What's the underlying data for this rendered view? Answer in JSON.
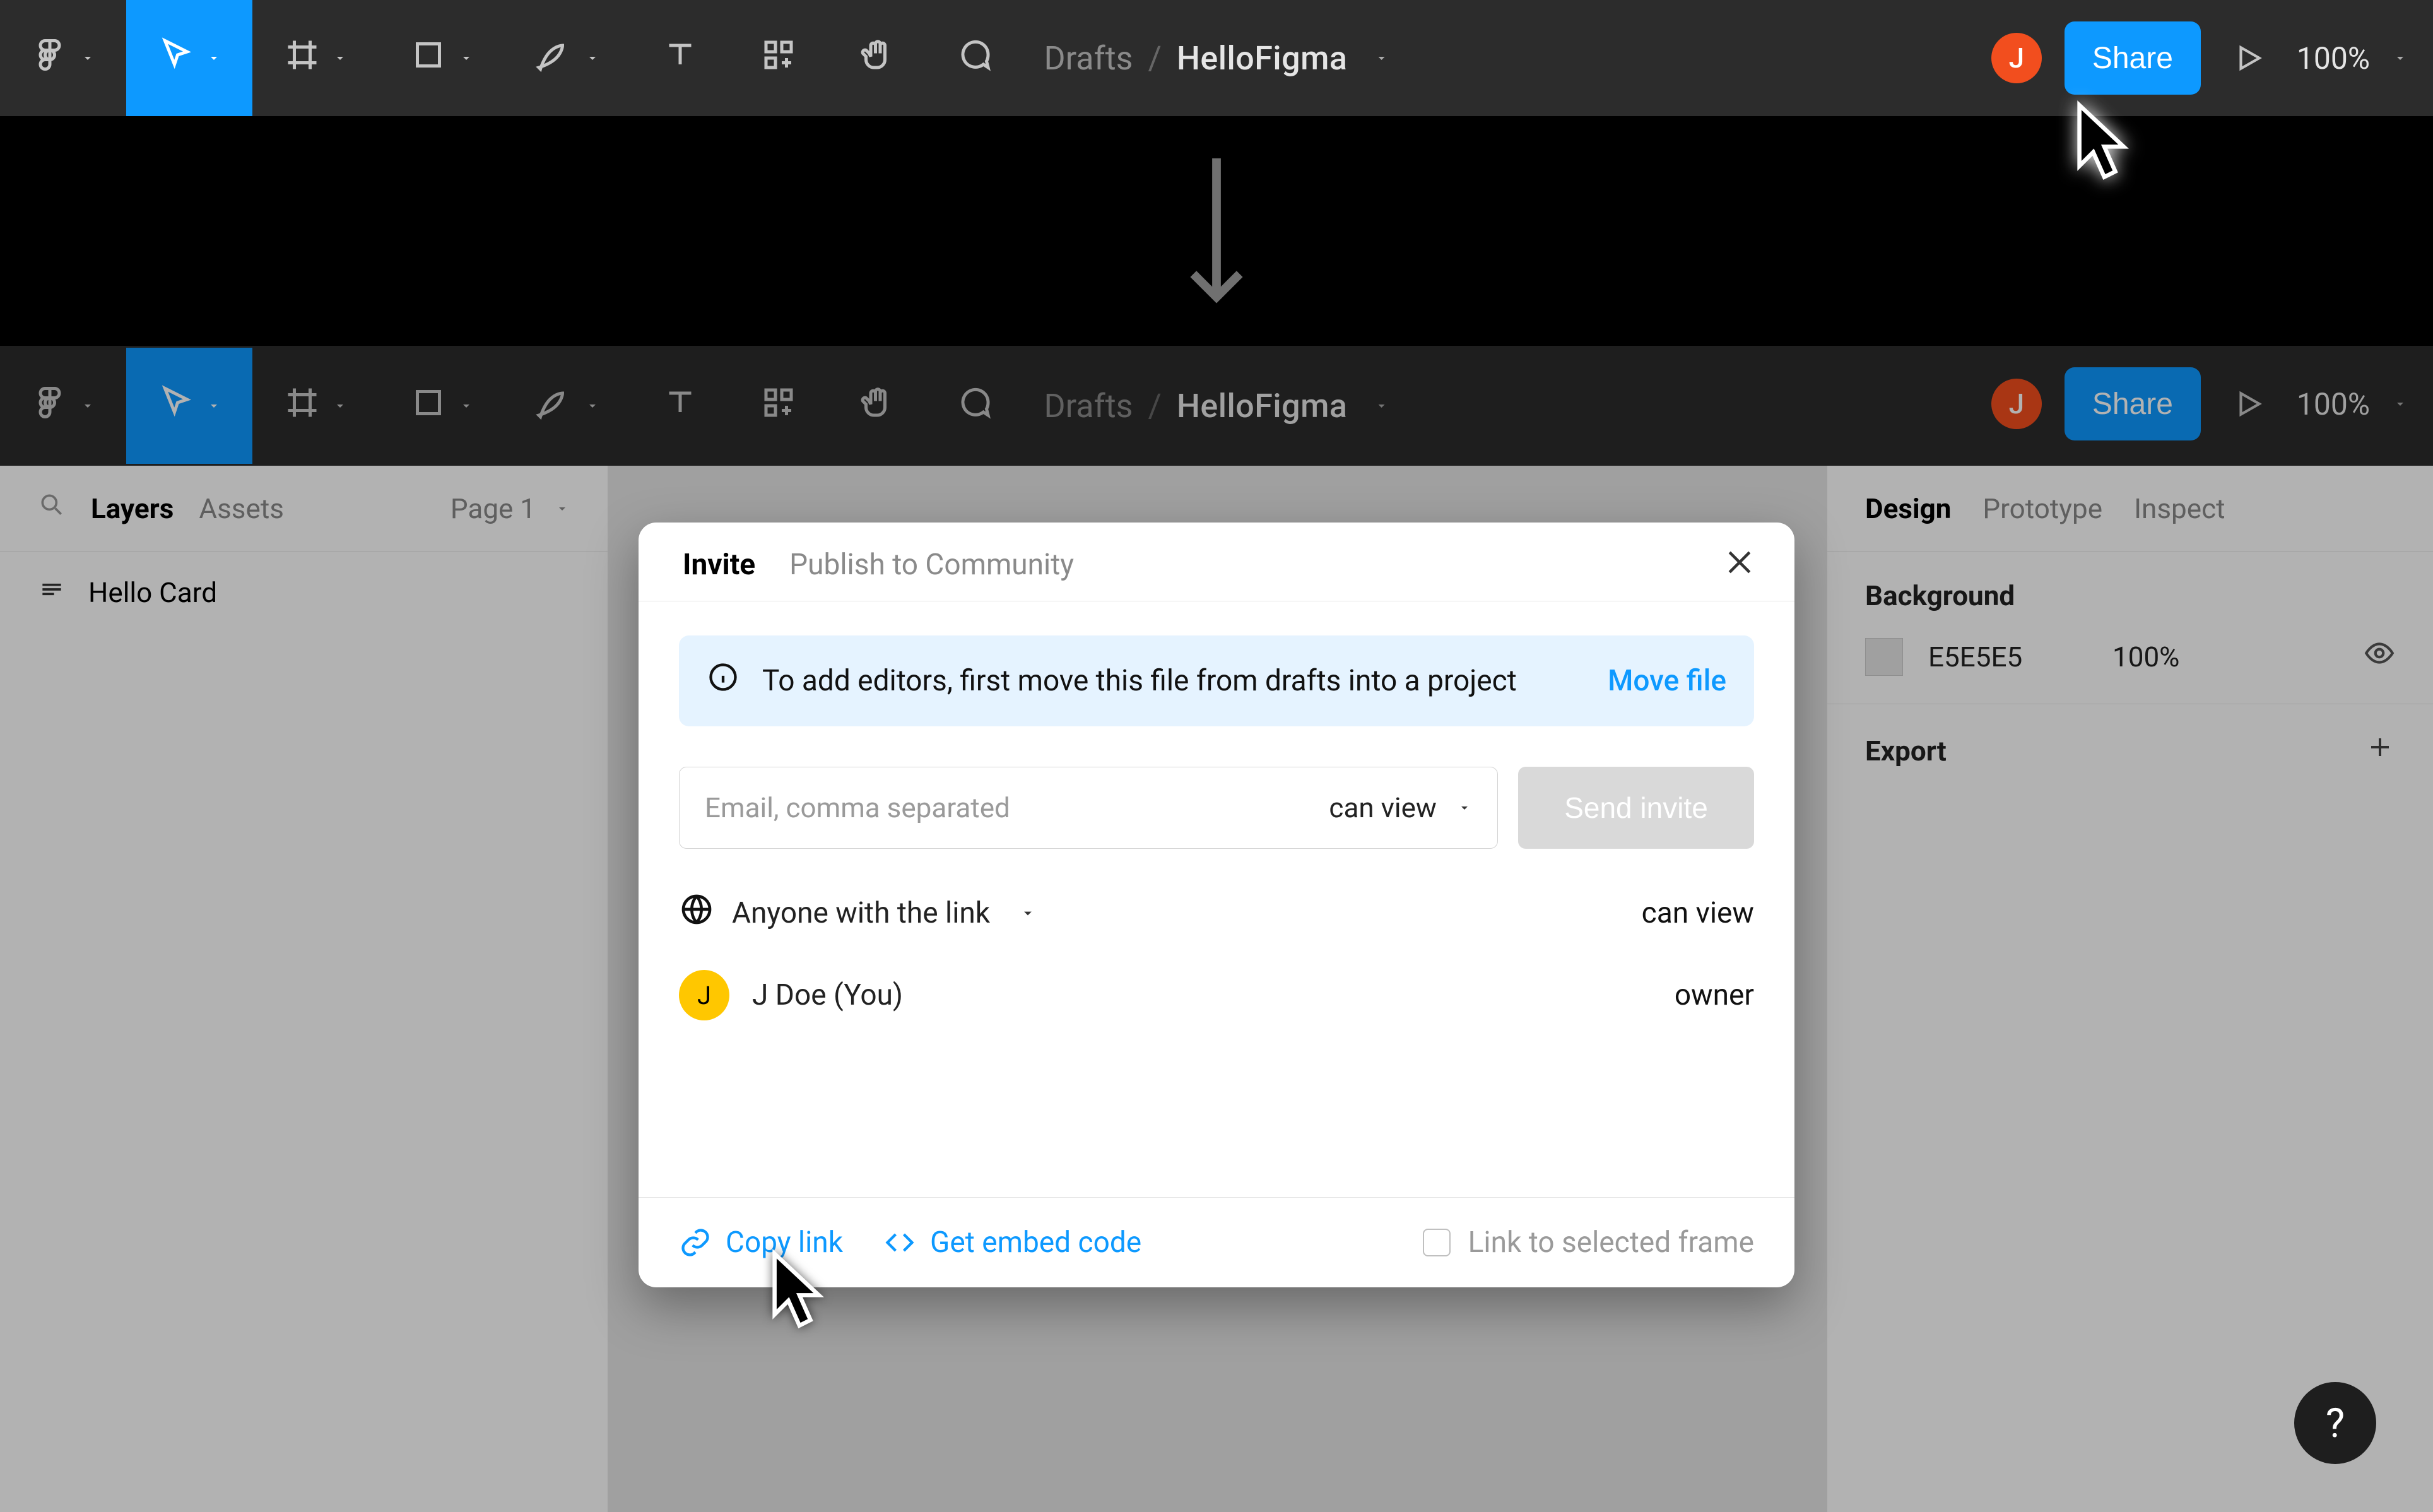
{
  "breadcrumb": {
    "drafts": "Drafts",
    "slash": "/",
    "filename": "HelloFigma"
  },
  "avatar": {
    "initial": "J"
  },
  "share_label": "Share",
  "zoom": "100%",
  "left_panel": {
    "layers_tab": "Layers",
    "assets_tab": "Assets",
    "page_label": "Page 1",
    "layer_name": "Hello Card"
  },
  "right_panel": {
    "design_tab": "Design",
    "prototype_tab": "Prototype",
    "inspect_tab": "Inspect",
    "bg_title": "Background",
    "bg_hex": "E5E5E5",
    "bg_opacity": "100%",
    "export_title": "Export"
  },
  "modal": {
    "tab_invite": "Invite",
    "tab_publish": "Publish to Community",
    "banner_text": "To add editors, first move this file from drafts into a project",
    "banner_cta": "Move file",
    "email_placeholder": "Email, comma separated",
    "perm_can_view": "can view",
    "send_label": "Send invite",
    "anyone_label": "Anyone with the link",
    "anyone_perm": "can view",
    "user_name": "J Doe (You)",
    "user_avatar_initial": "J",
    "user_role": "owner",
    "copy_link": "Copy link",
    "embed_code": "Get embed code",
    "link_to_frame": "Link to selected frame"
  },
  "help_label": "?"
}
